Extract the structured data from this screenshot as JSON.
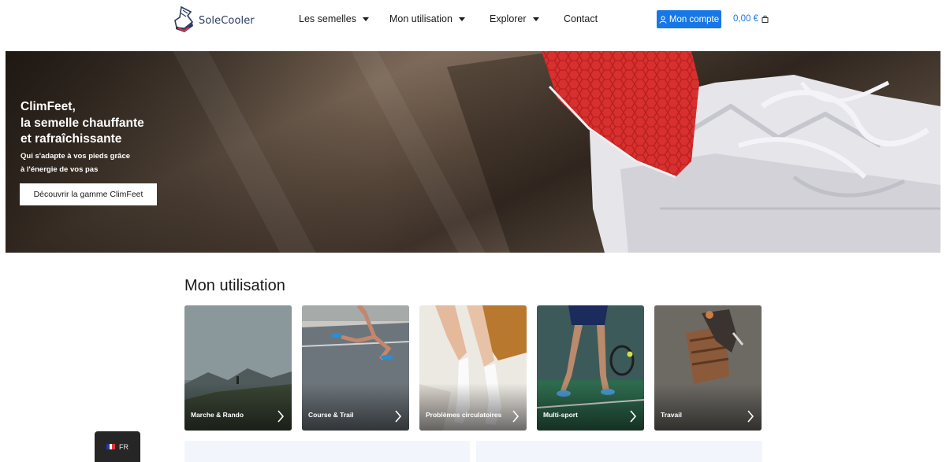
{
  "header": {
    "brand": "SoleCooler",
    "nav": [
      {
        "label": "Les semelles",
        "has_dropdown": true
      },
      {
        "label": "Mon utilisation",
        "has_dropdown": true
      },
      {
        "label": "Explorer",
        "has_dropdown": true
      },
      {
        "label": "Contact",
        "has_dropdown": false
      }
    ],
    "account_label": "Mon compte",
    "cart_total": "0,00 €",
    "accent_color": "#1877e6"
  },
  "hero": {
    "title_lines": [
      "ClimFeet,",
      "la semelle chauffante",
      "et rafraîchissante"
    ],
    "subtitle_lines": [
      "Qui s'adapte à vos pieds grâce",
      "à l'énergie de vos pas"
    ],
    "button_label": "Découvrir la gamme ClimFeet"
  },
  "usage": {
    "title": "Mon utilisation",
    "cards": [
      {
        "label": "Marche & Rando",
        "icon": "chevron-right-icon"
      },
      {
        "label": "Course & Trail",
        "icon": "chevron-right-icon"
      },
      {
        "label": "Problèmes circulatoires",
        "icon": "chevron-right-icon"
      },
      {
        "label": "Multi-sport",
        "icon": "chevron-right-icon"
      },
      {
        "label": "Travail",
        "icon": "chevron-right-icon"
      }
    ]
  },
  "language": {
    "code": "FR",
    "icon": "france-flag-icon"
  }
}
